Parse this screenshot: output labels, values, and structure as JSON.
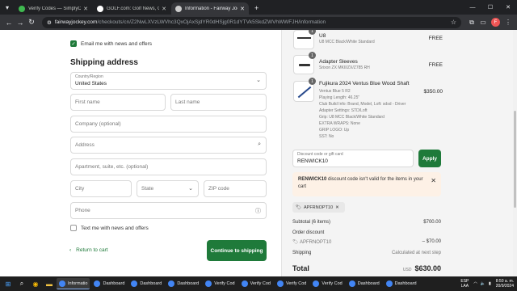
{
  "browser": {
    "tabs": [
      {
        "title": "Verify Codes — SimplyCodes",
        "active": false,
        "favicon_color": "#3fb950"
      },
      {
        "title": "GOLF.com: Golf News, Golf Equip",
        "active": false,
        "favicon_color": "#ffffff"
      },
      {
        "title": "Information - Fairway Jockey -",
        "active": true,
        "favicon_color": "#cccccc"
      }
    ],
    "url_domain": "fairwayjockey.com",
    "url_path": "/checkouts/cn/Z2NwLXVzLWVhc3QxOjAxSjdYR0dHSjg0R1dYTVk5SkdZWVhWWFJH/information",
    "profile_initial": "F"
  },
  "form": {
    "email_news_label": "Email me with news and offers",
    "shipping_heading": "Shipping address",
    "country_label": "Country/Region",
    "country_value": "United States",
    "first_name_placeholder": "First name",
    "last_name_placeholder": "Last name",
    "company_placeholder": "Company (optional)",
    "address_placeholder": "Address",
    "apartment_placeholder": "Apartment, suite, etc. (optional)",
    "city_placeholder": "City",
    "state_placeholder": "State",
    "zip_placeholder": "ZIP code",
    "phone_placeholder": "Phone",
    "text_news_label": "Text me with news and offers",
    "return_label": "Return to cart",
    "continue_label": "Continue to shipping"
  },
  "items": [
    {
      "qty": "1",
      "name": "U8",
      "details": [
        "U8 MCC Black/White Standard"
      ],
      "price": "FREE"
    },
    {
      "qty": "1",
      "name": "Adapter Sleeves",
      "details": [
        "Srixon ZX MKII/ZX/Z785 RH"
      ],
      "price": "FREE"
    },
    {
      "qty": "1",
      "name": "Fujikura 2024 Ventus Blue Wood Shaft",
      "details": [
        "Ventus Blue 5 R2",
        "Playing Length: 46.25\"",
        "Club Build Info: Brand, Model, Loft: sdsd - Driver",
        "Adapter Settings: STD/Loft",
        "Grip: U8 MCC Black/White Standard",
        "EXTRA WRAPS: None",
        "GRIP LOGO: Up",
        "SST: No"
      ],
      "price": "$350.00"
    }
  ],
  "discount": {
    "label": "Discount code or gift card",
    "value": "RENWICK10",
    "apply_label": "Apply",
    "alert_code": "RENWICK10",
    "alert_text": " discount code isn't valid for the items in your cart",
    "tag_label": "APFRNOPT10"
  },
  "summary": {
    "subtotal_label": "Subtotal (6 items)",
    "subtotal_value": "$700.00",
    "order_discount_label": "Order discount",
    "discount_code": "APFRNOPT10",
    "discount_value": "– $70.00",
    "shipping_label": "Shipping",
    "shipping_value": "Calculated at next step",
    "total_label": "Total",
    "currency": "USD",
    "total_value": "$630.00"
  },
  "taskbar": {
    "apps": [
      {
        "label": "Informatio",
        "color": "#4285f4",
        "active": true
      },
      {
        "label": "Dashboard",
        "color": "#4285f4",
        "active": false
      },
      {
        "label": "Dashboard",
        "color": "#4285f4",
        "active": false
      },
      {
        "label": "Dashboard",
        "color": "#4285f4",
        "active": false
      },
      {
        "label": "Verify Cod",
        "color": "#4285f4",
        "active": false
      },
      {
        "label": "Verify Cod",
        "color": "#4285f4",
        "active": false
      },
      {
        "label": "Verify Cod",
        "color": "#4285f4",
        "active": false
      },
      {
        "label": "Verify Cod",
        "color": "#4285f4",
        "active": false
      },
      {
        "label": "Dashboard",
        "color": "#4285f4",
        "active": false
      },
      {
        "label": "Dashboard",
        "color": "#4285f4",
        "active": false
      }
    ],
    "lang_top": "ESP",
    "lang_bottom": "LAA",
    "time": "8:50 a. m.",
    "date": "20/9/2024"
  }
}
